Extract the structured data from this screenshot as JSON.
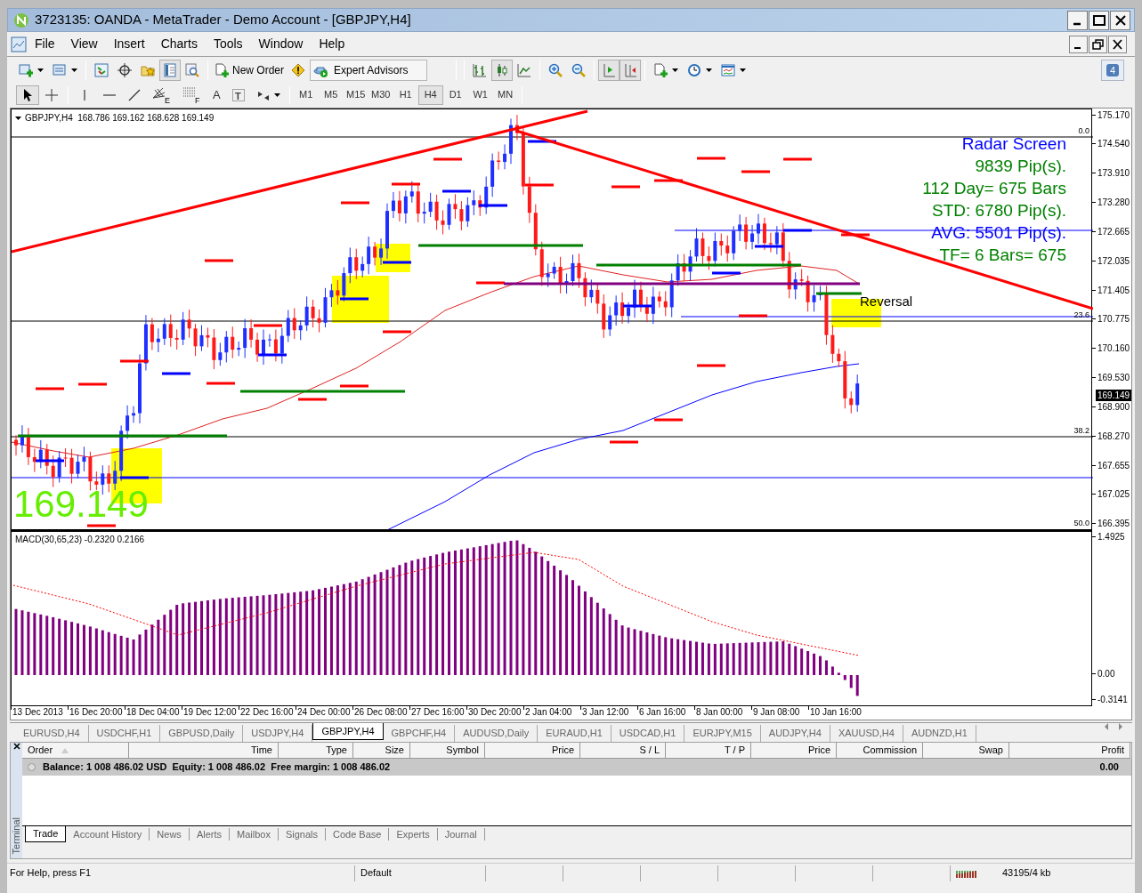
{
  "window": {
    "title": "3723135: OANDA - MetaTrader - Demo Account - [GBPJPY,H4]"
  },
  "menu": [
    "File",
    "View",
    "Insert",
    "Charts",
    "Tools",
    "Window",
    "Help"
  ],
  "toolbar": {
    "new_order": "New Order",
    "expert_advisors": "Expert Advisors",
    "notifications": "4"
  },
  "drawing_tools": {
    "fan_mark": "E",
    "fibo_mark": "F",
    "text_tool": "A",
    "label_tool": "T"
  },
  "timeframes": [
    {
      "label": "M1",
      "selected": false
    },
    {
      "label": "M5",
      "selected": false
    },
    {
      "label": "M15",
      "selected": false
    },
    {
      "label": "M30",
      "selected": false
    },
    {
      "label": "H1",
      "selected": false
    },
    {
      "label": "H4",
      "selected": true
    },
    {
      "label": "D1",
      "selected": false
    },
    {
      "label": "W1",
      "selected": false
    },
    {
      "label": "MN",
      "selected": false
    }
  ],
  "chart": {
    "header": "GBPJPY,H4  168.786 169.162 168.628 169.149",
    "radar": [
      {
        "text": "Radar Screen",
        "color": "#0000ff"
      },
      {
        "text": "9839 Pip(s).",
        "color": "#008000"
      },
      {
        "text": "112 Day= 675 Bars",
        "color": "#008000"
      },
      {
        "text": "STD: 6780 Pip(s).",
        "color": "#008000"
      },
      {
        "text": "AVG: 5501 Pip(s).",
        "color": "#0000ff"
      },
      {
        "text": "TF= 6 Bars= 675",
        "color": "#008000"
      }
    ],
    "reversal_label": "Reversal",
    "big_price": "169.149",
    "fib_levels": [
      "0.0",
      "23.6",
      "38.2",
      "50.0"
    ],
    "price_axis": [
      "175.170",
      "174.540",
      "173.910",
      "173.280",
      "172.665",
      "172.035",
      "171.405",
      "170.775",
      "170.160",
      "169.530",
      "168.900",
      "168.270",
      "167.655",
      "167.025",
      "166.395"
    ],
    "current_price": "169.149",
    "macd_header": "MACD(30,65,23) -0.2320 0.2166",
    "macd_axis": [
      "1.4925",
      "0.00",
      "-0.3141"
    ],
    "time_axis": [
      "13 Dec 2013",
      "16 Dec 20:00",
      "18 Dec 04:00",
      "19 Dec 12:00",
      "22 Dec 16:00",
      "24 Dec 00:00",
      "26 Dec 08:00",
      "27 Dec 16:00",
      "30 Dec 20:00",
      "2 Jan 04:00",
      "3 Jan 12:00",
      "6 Jan 16:00",
      "8 Jan 00:00",
      "9 Jan 08:00",
      "10 Jan 16:00"
    ]
  },
  "chart_tabs": [
    {
      "label": "EURUSD,H4",
      "selected": false
    },
    {
      "label": "USDCHF,H1",
      "selected": false
    },
    {
      "label": "GBPUSD,Daily",
      "selected": false
    },
    {
      "label": "USDJPY,H4",
      "selected": false
    },
    {
      "label": "GBPJPY,H4",
      "selected": true
    },
    {
      "label": "GBPCHF,H4",
      "selected": false
    },
    {
      "label": "AUDUSD,Daily",
      "selected": false
    },
    {
      "label": "EURAUD,H1",
      "selected": false
    },
    {
      "label": "USDCAD,H1",
      "selected": false
    },
    {
      "label": "EURJPY,M15",
      "selected": false
    },
    {
      "label": "AUDJPY,H4",
      "selected": false
    },
    {
      "label": "XAUUSD,H4",
      "selected": false
    },
    {
      "label": "AUDNZD,H1",
      "selected": false
    }
  ],
  "terminal": {
    "side_label": "Terminal",
    "columns": [
      "Order",
      "Time",
      "Type",
      "Size",
      "Symbol",
      "Price",
      "S / L",
      "T / P",
      "Price",
      "Commission",
      "Swap",
      "Profit"
    ],
    "balance_row": {
      "summary": "Balance: 1 008 486.02 USD  Equity: 1 008 486.02  Free margin: 1 008 486.02",
      "profit": "0.00"
    },
    "tabs": [
      {
        "label": "Trade",
        "selected": true
      },
      {
        "label": "Account History",
        "selected": false
      },
      {
        "label": "News",
        "selected": false
      },
      {
        "label": "Alerts",
        "selected": false
      },
      {
        "label": "Mailbox",
        "selected": false
      },
      {
        "label": "Signals",
        "selected": false
      },
      {
        "label": "Code Base",
        "selected": false
      },
      {
        "label": "Experts",
        "selected": false
      },
      {
        "label": "Journal",
        "selected": false
      }
    ]
  },
  "status_bar": {
    "help": "For Help, press F1",
    "profile": "Default",
    "traffic": "43195/4 kb"
  }
}
